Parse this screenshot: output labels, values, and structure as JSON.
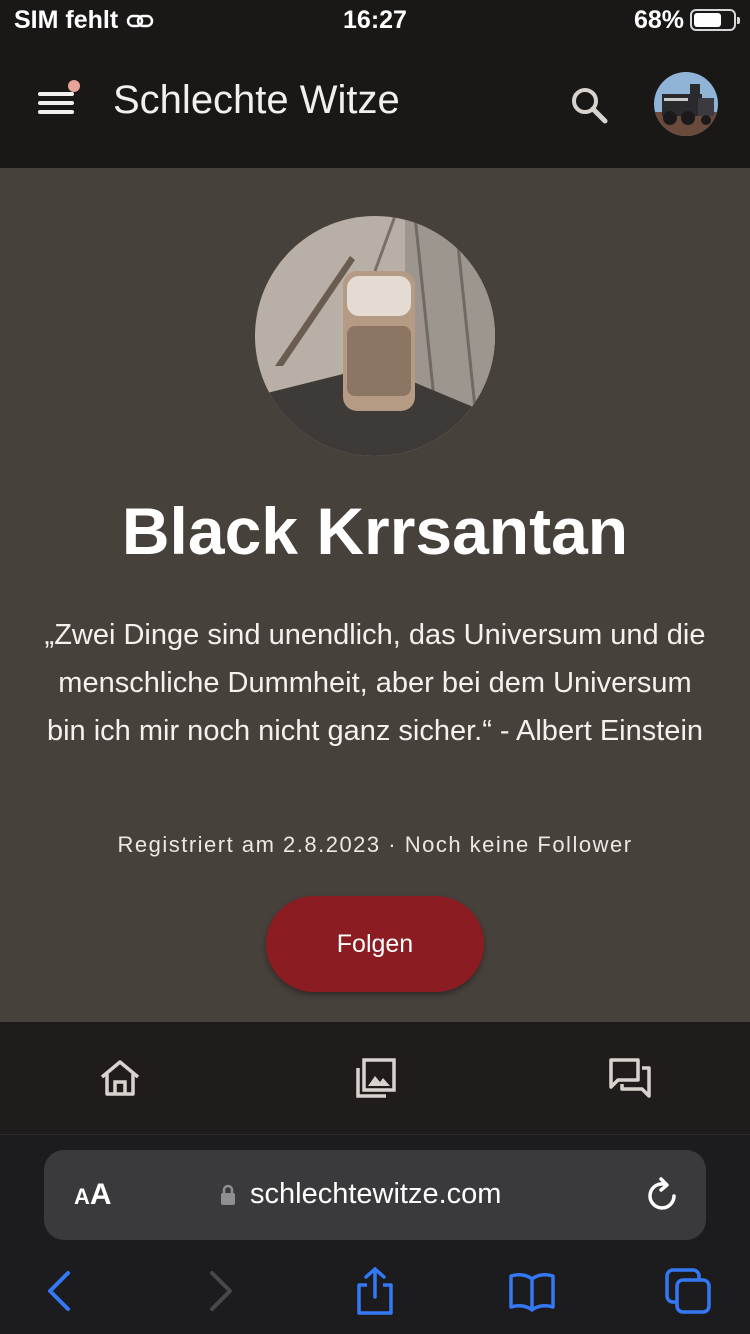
{
  "status": {
    "carrier": "SIM fehlt",
    "time": "16:27",
    "battery": "68%",
    "battery_level": 0.68
  },
  "appbar": {
    "title": "Schlechte Witze"
  },
  "profile": {
    "name": "Black Krrsantan",
    "quote": "„Zwei Dinge sind unendlich, das Universum und die menschliche Dummheit, aber bei dem Universum bin ich mir noch nicht ganz sicher.“ - Albert Einstein",
    "meta": "Registriert am 2.8.2023 · Noch keine Follower",
    "follow_label": "Folgen"
  },
  "bottomnav": {
    "items": [
      {
        "icon": "home-icon"
      },
      {
        "icon": "gallery-icon"
      },
      {
        "icon": "forum-icon"
      }
    ]
  },
  "browser": {
    "text_size_small": "A",
    "text_size_large": "A",
    "url": "schlechtewitze.com"
  },
  "colors": {
    "accent": "#8a1c22",
    "card_bg": "#47413c",
    "bar_bg": "#1a1817",
    "ios_blue": "#3478f6"
  }
}
